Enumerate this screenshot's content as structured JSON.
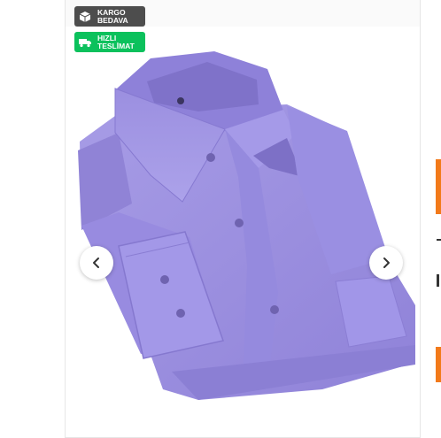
{
  "badges": {
    "cargo": {
      "line1": "KARGO",
      "line2": "BEDAVA",
      "icon": "box-icon"
    },
    "fast": {
      "line1": "HIZLI",
      "line2": "TESLİMAT",
      "icon": "truck-icon"
    }
  },
  "image": {
    "alt": "Lavender long-sleeve dress shirt",
    "subject": "shirt"
  },
  "carousel": {
    "prev_icon": "chevron-left-icon",
    "next_icon": "chevron-right-icon"
  },
  "colors": {
    "cargo_badge": "#4d4d4d",
    "fast_badge": "#0bc15c",
    "shirt": "#9a8fe0",
    "accent": "#f27a1a"
  }
}
